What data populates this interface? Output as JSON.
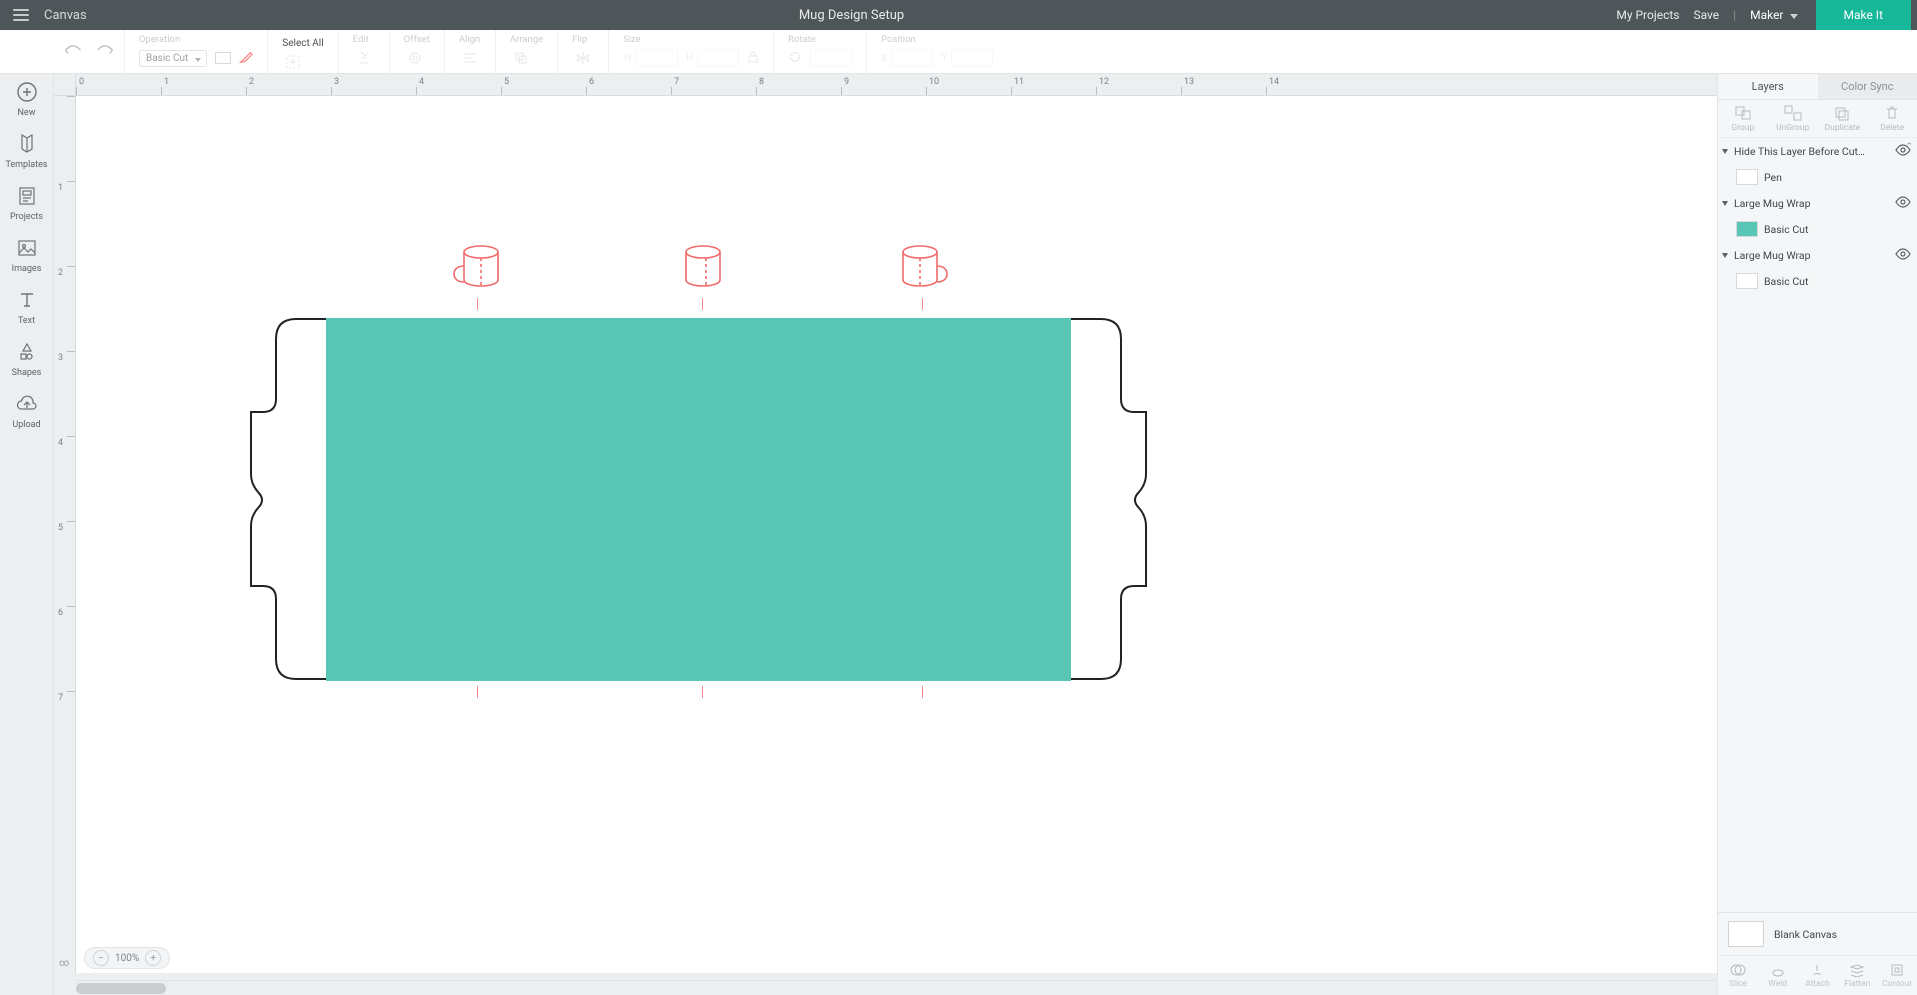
{
  "header": {
    "brand": "Canvas",
    "title": "Mug Design Setup",
    "my_projects": "My Projects",
    "save": "Save",
    "machine": "Maker",
    "make_it": "Make It"
  },
  "toolbar": {
    "operation": "Operation",
    "op_value": "Basic Cut",
    "select_all": "Select All",
    "edit": "Edit",
    "offset": "Offset",
    "align": "Align",
    "arrange": "Arrange",
    "flip": "Flip",
    "size": "Size",
    "w": "W",
    "h": "H",
    "rotate": "Rotate",
    "position": "Position",
    "x": "X",
    "y": "Y"
  },
  "rail": {
    "new": "New",
    "templates": "Templates",
    "projects": "Projects",
    "images": "Images",
    "text": "Text",
    "shapes": "Shapes",
    "upload": "Upload"
  },
  "ruler_h": [
    "0",
    "1",
    "2",
    "3",
    "4",
    "5",
    "6",
    "7",
    "8",
    "9",
    "10",
    "11",
    "12",
    "13",
    "14"
  ],
  "ruler_v": [
    "",
    "1",
    "2",
    "3",
    "4",
    "5",
    "6",
    "7"
  ],
  "ruler_inf": "∞",
  "zoom": "100%",
  "panel": {
    "tab_layers": "Layers",
    "tab_colorsync": "Color Sync",
    "actions": {
      "group": "Group",
      "ungroup": "UnGroup",
      "duplicate": "Duplicate",
      "delete": "Delete"
    },
    "actions2": {
      "slice": "Slice",
      "weld": "Weld",
      "attach": "Attach",
      "flatten": "Flatten",
      "contour": "Contour"
    },
    "layers": [
      {
        "name": "Hide This Layer Before Cut…",
        "sub": "Pen",
        "swcolor": "#ffffff"
      },
      {
        "name": "Large Mug Wrap",
        "sub": "Basic Cut",
        "swcolor": "#59c5b5"
      },
      {
        "name": "Large Mug Wrap",
        "sub": "Basic Cut",
        "swcolor": "#ffffff"
      }
    ],
    "blank_canvas": "Blank Canvas",
    "collapse": "⌃"
  },
  "colors": {
    "teal": "#59c5b5",
    "red": "#f06a6a"
  }
}
